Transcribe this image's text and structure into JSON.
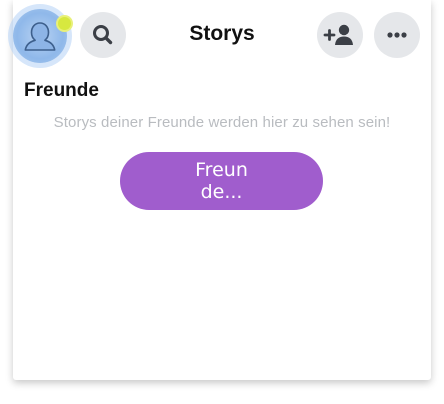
{
  "header": {
    "title": "Storys",
    "icons": {
      "avatar": "bitmoji-avatar-icon",
      "search": "search-icon",
      "add_friend": "add-friend-icon",
      "more": "more-icon"
    }
  },
  "section": {
    "heading": "Freunde",
    "empty_message": "Storys deiner Freunde werden hier zu sehen sein!",
    "button_label": "Freunde..."
  },
  "colors": {
    "accent_button": "#a05dcd",
    "icon_button_bg": "#e5e7ea",
    "notification_dot": "#d7e83f"
  }
}
